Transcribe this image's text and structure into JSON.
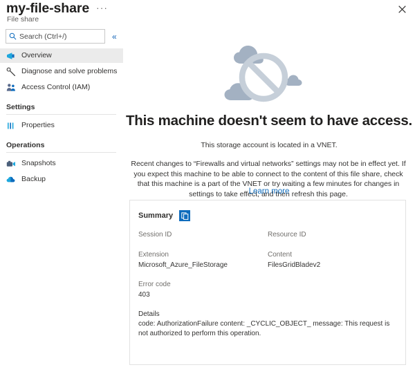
{
  "header": {
    "title": "my-file-share",
    "subtitle": "File share",
    "more_label": "···",
    "close_icon": "close-icon"
  },
  "sidebar": {
    "search": {
      "placeholder": "Search (Ctrl+/)",
      "value": "",
      "icon": "search-icon"
    },
    "collapse_label": "«",
    "items": [
      {
        "label": "Overview",
        "icon": "overview-icon",
        "selected": true
      },
      {
        "label": "Diagnose and solve problems",
        "icon": "wrench-icon",
        "selected": false
      },
      {
        "label": "Access Control (IAM)",
        "icon": "people-icon",
        "selected": false
      }
    ],
    "groups": [
      {
        "title": "Settings",
        "items": [
          {
            "label": "Properties",
            "icon": "properties-icon",
            "selected": false
          }
        ]
      },
      {
        "title": "Operations",
        "items": [
          {
            "label": "Snapshots",
            "icon": "snapshots-icon",
            "selected": false
          },
          {
            "label": "Backup",
            "icon": "backup-icon",
            "selected": false
          }
        ]
      }
    ]
  },
  "main": {
    "illustration": "no-access-cloud-illustration",
    "headline": "This machine doesn't seem to have access.",
    "subline": "This storage account is located in a VNET.",
    "paragraph": "Recent changes to “Firewalls and virtual networks” settings may not be in effect yet. If you expect this machine to be able to connect to the content of this file share, check that this machine is a part of the VNET or try waiting a few minutes for changes in settings to take effect, and then refresh this page.",
    "learn_more": "Learn more"
  },
  "summary": {
    "title": "Summary",
    "copy_icon": "copy-icon",
    "fields": [
      {
        "label": "Session ID",
        "value": ""
      },
      {
        "label": "Resource ID",
        "value": ""
      },
      {
        "label": "Extension",
        "value": "Microsoft_Azure_FileStorage"
      },
      {
        "label": "Content",
        "value": "FilesGridBladev2"
      },
      {
        "label": "Error code",
        "value": "403"
      }
    ],
    "details_label": "Details",
    "details_text": "code: AuthorizationFailure content: _CYCLIC_OBJECT_ message: This request is not authorized to perform this operation."
  },
  "colors": {
    "accent": "#0f6cbd",
    "link": "#0f6cbd",
    "selected_row": "#ebebeb",
    "illustration_cloud": "#a3b1c2",
    "illustration_sign": "#c6cfd9",
    "card_border": "#e1e1e1"
  }
}
